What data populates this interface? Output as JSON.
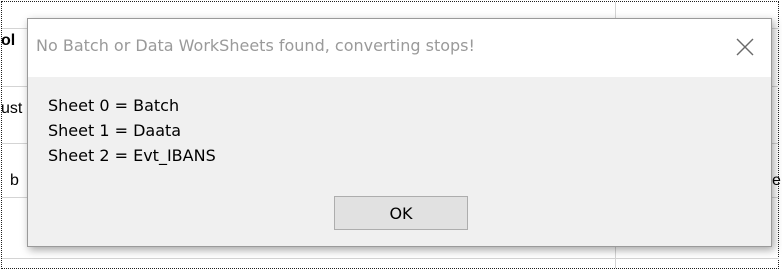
{
  "background": {
    "fragments": [
      "ol",
      "ust",
      "b",
      "e"
    ]
  },
  "dialog": {
    "title": "No Batch or Data WorkSheets found, converting stops!",
    "close_icon": "close-icon",
    "message_lines": [
      "Sheet 0 = Batch",
      "Sheet 1 = Daata",
      "Sheet 2 = Evt_IBANS"
    ],
    "ok_label": "OK"
  }
}
